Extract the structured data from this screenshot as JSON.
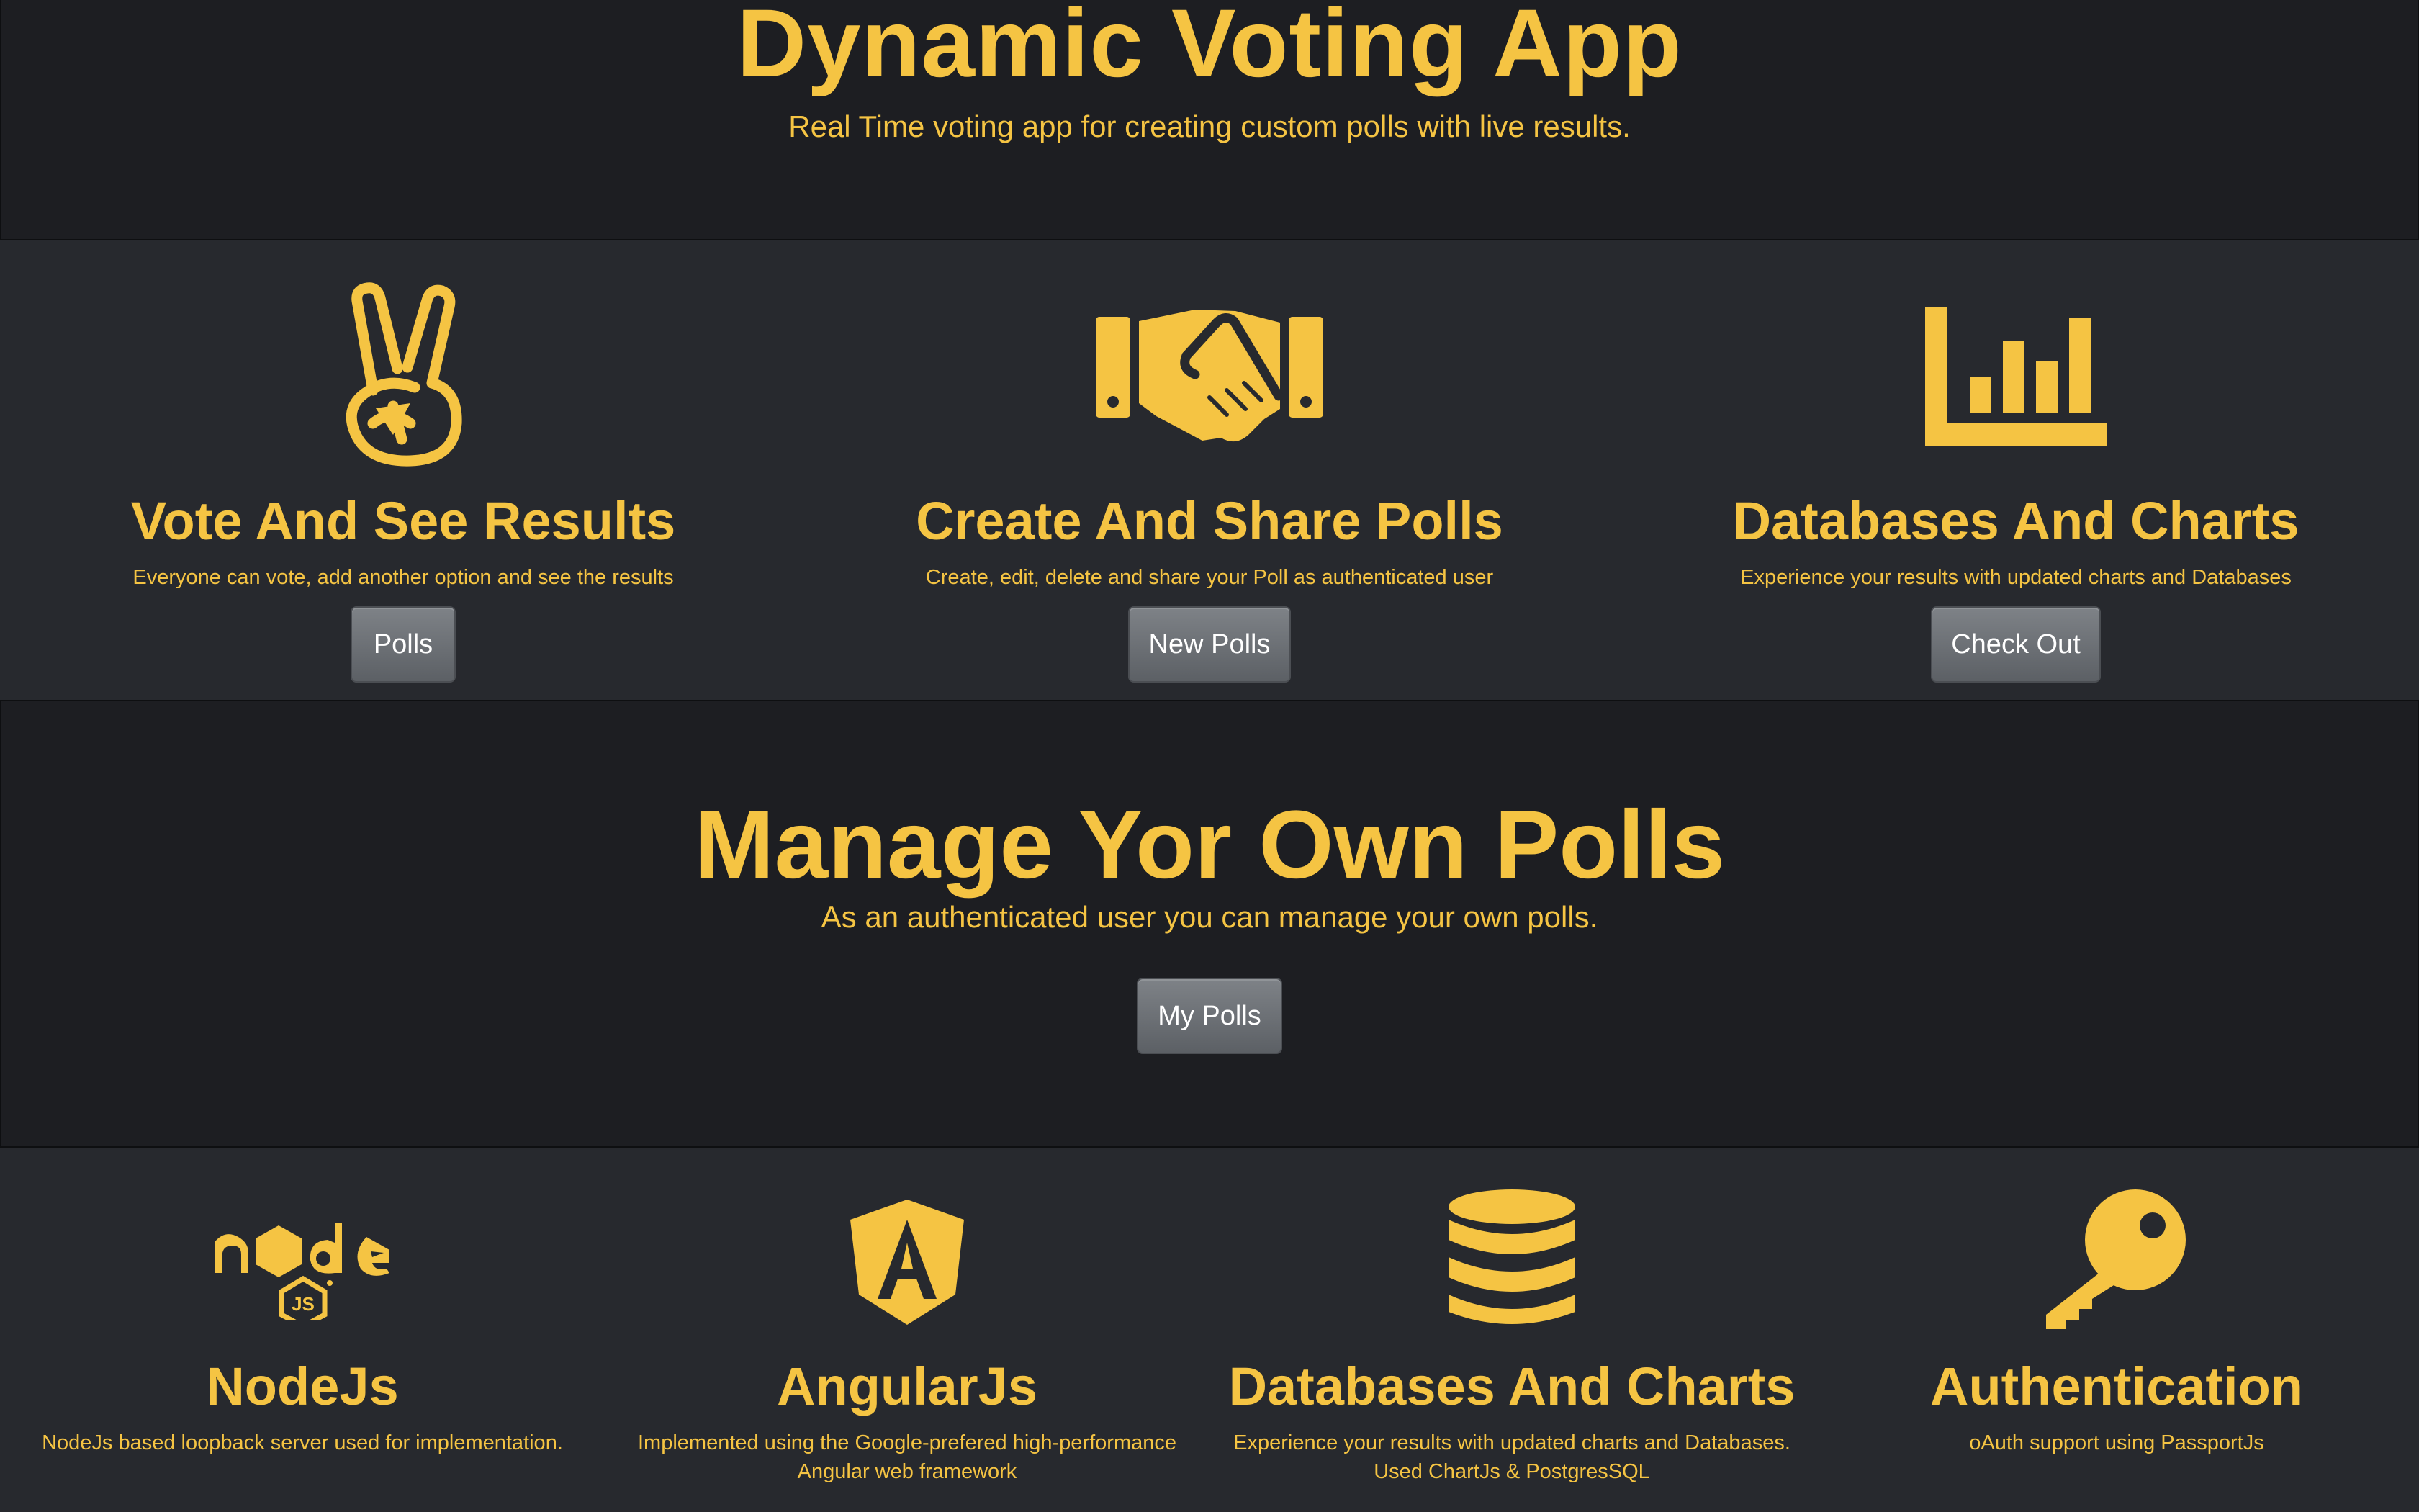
{
  "hero": {
    "title": "Dynamic Voting App",
    "subtitle": "Real Time voting app for creating custom polls with live results."
  },
  "features": [
    {
      "icon": "peace-hand-icon",
      "title": "Vote And See Results",
      "description": "Everyone can vote, add another option and see the results",
      "button": "Polls"
    },
    {
      "icon": "handshake-icon",
      "title": "Create And Share Polls",
      "description": "Create, edit, delete and share your Poll as authenticated user",
      "button": "New Polls"
    },
    {
      "icon": "bar-chart-icon",
      "title": "Databases And Charts",
      "description": "Experience your results with updated charts and Databases",
      "button": "Check Out"
    }
  ],
  "manage": {
    "title": "Manage Yor Own Polls",
    "subtitle": "As an authenticated user you can manage your own polls.",
    "button": "My Polls"
  },
  "tech": [
    {
      "icon": "nodejs-logo-icon",
      "title": "NodeJs",
      "description": "NodeJs based loopback server used for implementation."
    },
    {
      "icon": "angular-logo-icon",
      "title": "AngularJs",
      "description_line1": "Implemented using the Google-prefered high-performance",
      "description_line2": "Angular web framework"
    },
    {
      "icon": "database-icon",
      "title": "Databases And Charts",
      "description_line1": "Experience your results with updated charts and Databases.",
      "description_line2": "Used ChartJs & PostgresSQL"
    },
    {
      "icon": "key-icon",
      "title": "Authentication",
      "description": "oAuth support using PassportJs"
    }
  ],
  "colors": {
    "accent": "#f5c443",
    "dark_bg": "#1d1e22",
    "panel_bg": "#27292e",
    "button_bg": "#6b6f74"
  }
}
